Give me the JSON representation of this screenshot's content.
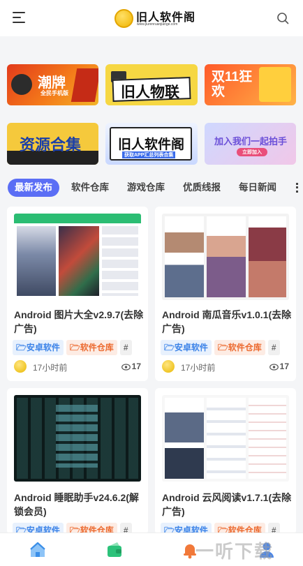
{
  "header": {
    "logo_text": "旧人软件阁",
    "logo_url": "www.jiurenruanjiange.com"
  },
  "banners": [
    {
      "text": "潮牌",
      "sub": "全民手机版"
    },
    {
      "text": "旧人物联"
    },
    {
      "text": "双11狂欢"
    },
    {
      "text": "资源合集"
    },
    {
      "text": "旧人软件阁",
      "sub": "获取APP汇总列表合集"
    },
    {
      "text": "加入我们一起拍手",
      "sub": "立即加入"
    }
  ],
  "tabs": [
    "最新发布",
    "软件仓库",
    "游戏仓库",
    "优质线报",
    "每日新闻"
  ],
  "tag_icons": {
    "folder": "folder-icon",
    "hash": "hash-icon"
  },
  "posts": [
    {
      "title": "Android 图片大全v2.9.7(去除广告)",
      "tags": [
        "安卓软件",
        "软件仓库",
        "#"
      ],
      "time": "17小时前",
      "views": "17"
    },
    {
      "title": "Android 南瓜音乐v1.0.1(去除广告)",
      "tags": [
        "安卓软件",
        "软件仓库",
        "#"
      ],
      "time": "17小时前",
      "views": "17"
    },
    {
      "title": "Android 睡眠助手v24.6.2(解锁会员)",
      "tags": [
        "安卓软件",
        "软件仓库",
        "#"
      ]
    },
    {
      "title": "Android 云风阅读v1.7.1(去除广告)",
      "tags": [
        "安卓软件",
        "软件仓库",
        "#"
      ]
    }
  ],
  "watermark": "一听下载",
  "colors": {
    "accent": "#5b6ef5",
    "tag_blue": "#3a82e8",
    "tag_orange": "#ec6a2f"
  }
}
